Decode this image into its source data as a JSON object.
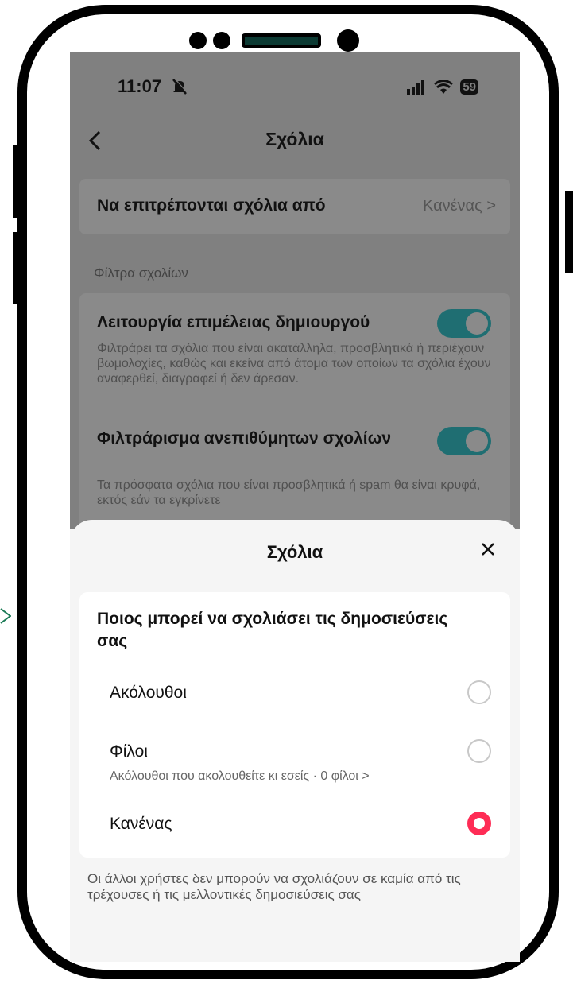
{
  "status_bar": {
    "time": "11:07",
    "bell_icon": "bell-slash-icon",
    "signal_icon": "signal-bars-icon",
    "wifi_icon": "wifi-icon",
    "battery": "59"
  },
  "header": {
    "title": "Σχόλια",
    "back_icon": "chevron-left-icon"
  },
  "allow_comments": {
    "label": "Να επιτρέπονται σχόλια από",
    "value": "Κανένας >"
  },
  "filters": {
    "section_label": "Φίλτρα σχολίων",
    "items": [
      {
        "title": "Λειτουργία επιμέλειας δημιουργού",
        "description": "Φιλτράρει τα σχόλια που είναι ακατάλληλα, προσβλητικά ή περιέχουν βωμολοχίες, καθώς και εκείνα από άτομα των οποίων τα σχόλια έχουν αναφερθεί, διαγραφεί ή δεν άρεσαν.",
        "enabled": true
      },
      {
        "title": "Φιλτράρισμα ανεπιθύμητων σχολίων",
        "description": "Τα πρόσφατα σχόλια που είναι προσβλητικά ή spam θα είναι κρυφά, εκτός εάν τα εγκρίνετε",
        "enabled": true
      }
    ]
  },
  "sheet": {
    "title": "Σχόλια",
    "close_icon": "close-icon",
    "question": "Ποιος μπορεί να σχολιάσει τις δημοσιεύσεις σας",
    "options": [
      {
        "label": "Ακόλουθοι",
        "selected": false
      },
      {
        "label": "Φίλοι",
        "sub": "Ακόλουθοι που ακολουθείτε κι εσείς · 0 φίλοι >",
        "selected": false
      },
      {
        "label": "Κανένας",
        "selected": true
      }
    ],
    "footnote": "Οι άλλοι χρήστες δεν μπορούν να σχολιάζουν σε καμία από τις τρέχουσες ή τις μελλοντικές δημοσιεύσεις σας"
  },
  "colors": {
    "accent": "#fe2c55",
    "toggle": "#1f6e72"
  }
}
